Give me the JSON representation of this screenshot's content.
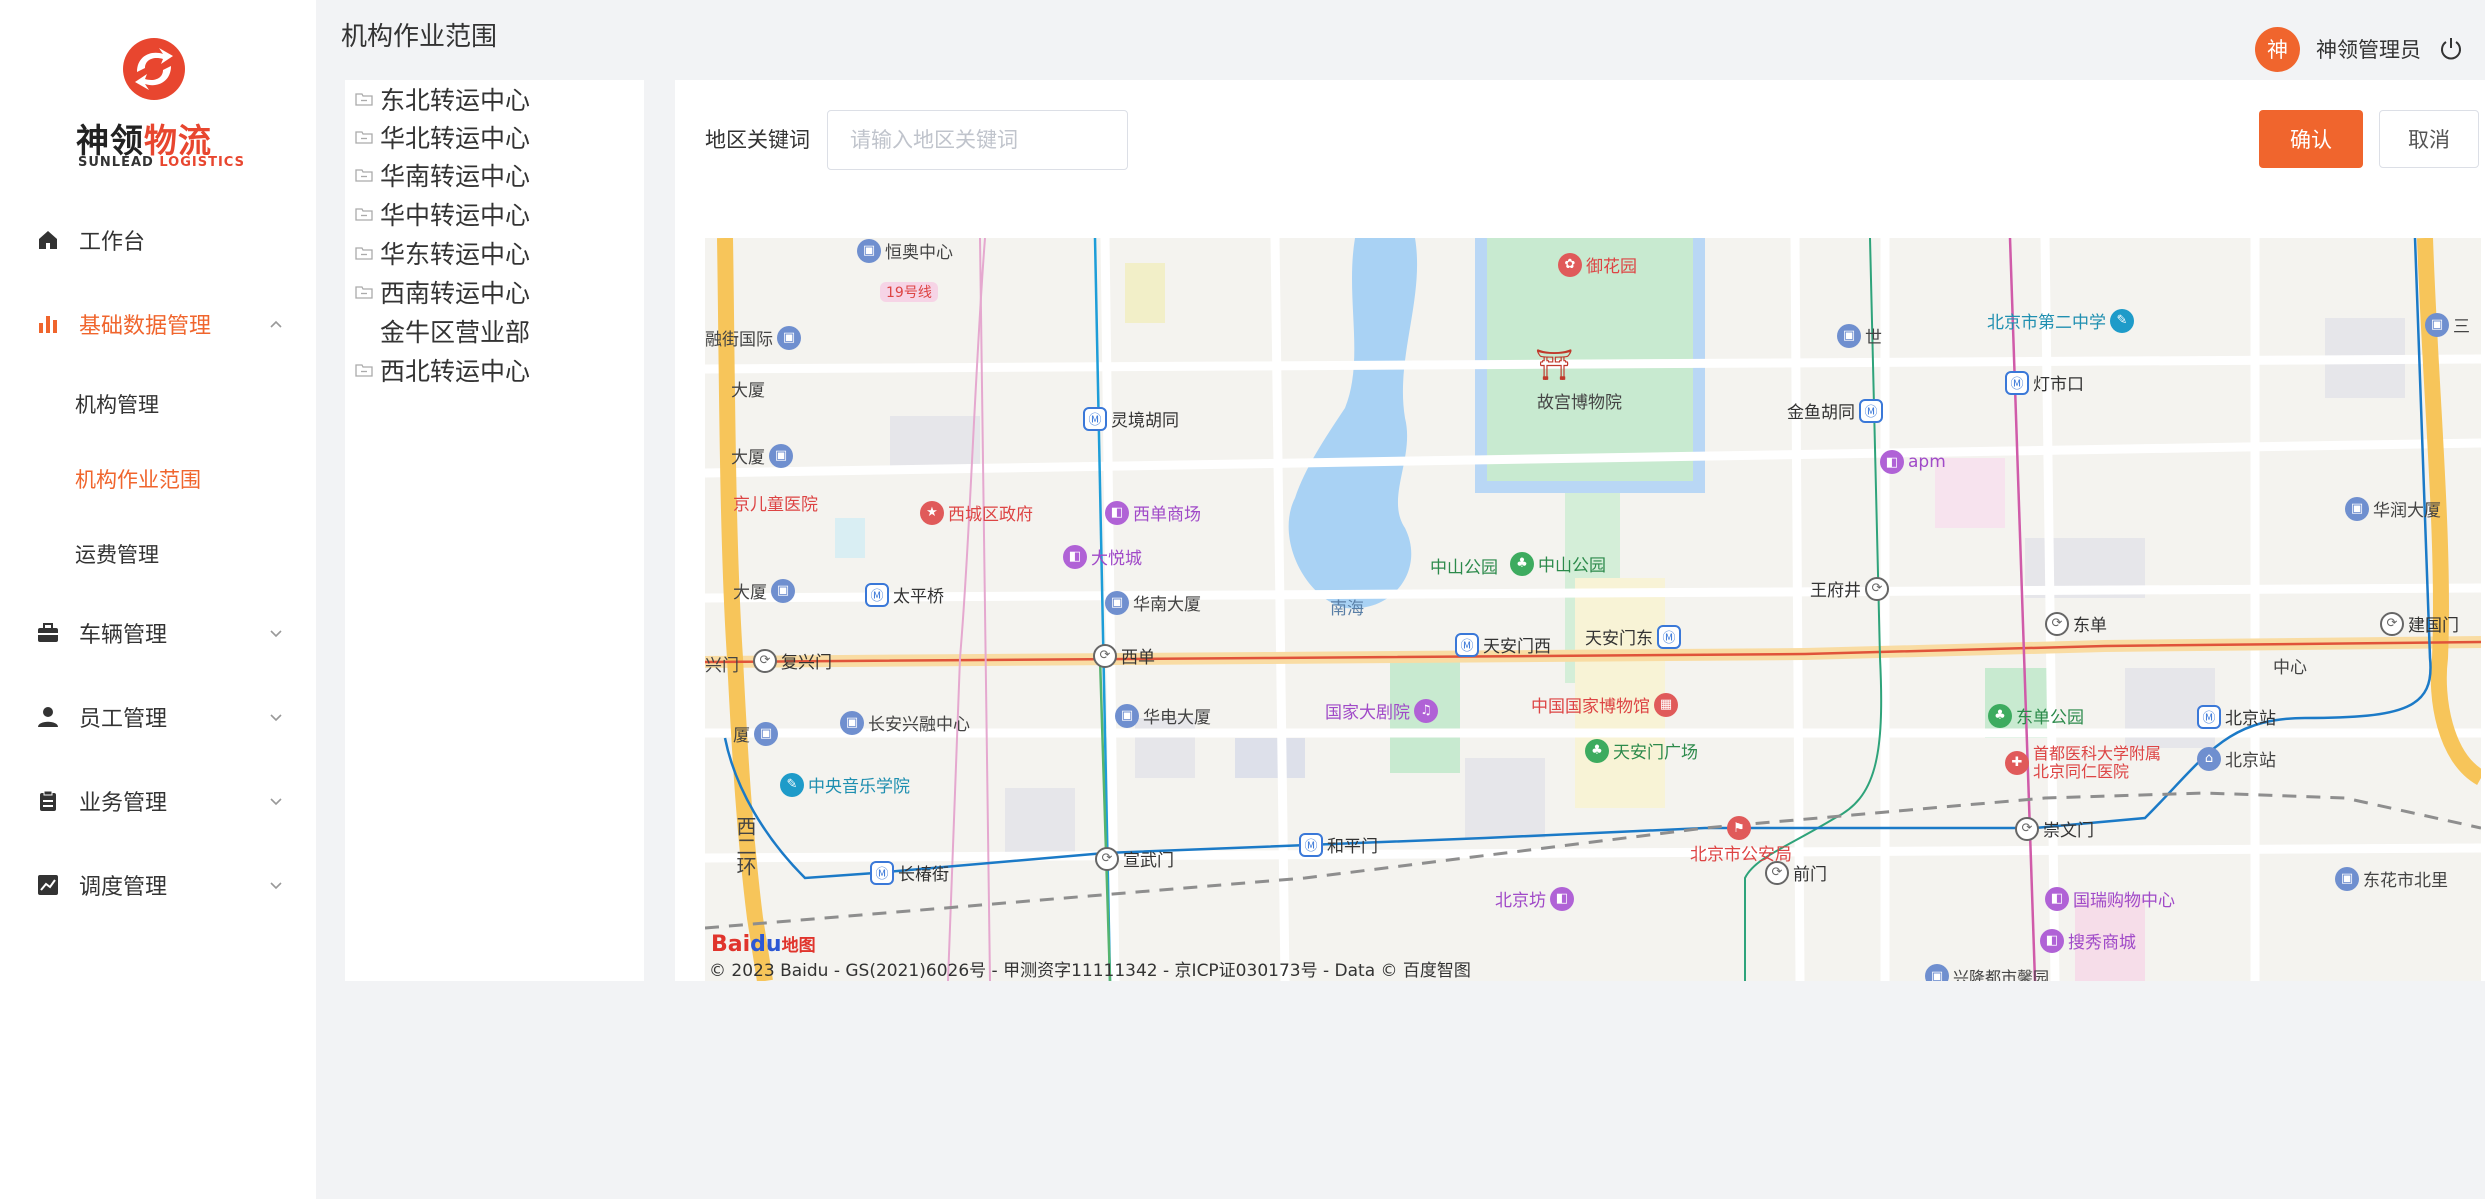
{
  "logo": {
    "brand_a": "神领",
    "brand_b": "物流",
    "sub_a": "SUNLEAD",
    "sub_b": "LOGISTICS"
  },
  "menu": {
    "workbench": "工作台",
    "basic_data": "基础数据管理",
    "sub": {
      "org": "机构管理",
      "org_scope": "机构作业范围",
      "freight": "运费管理"
    },
    "vehicle": "车辆管理",
    "staff": "员工管理",
    "business": "业务管理",
    "dispatch": "调度管理"
  },
  "header": {
    "title": "机构作业范围",
    "avatar_char": "神",
    "user_name": "神领管理员"
  },
  "tree": [
    {
      "label": "东北转运中心",
      "folder": true
    },
    {
      "label": "华北转运中心",
      "folder": true
    },
    {
      "label": "华南转运中心",
      "folder": true
    },
    {
      "label": "华中转运中心",
      "folder": true
    },
    {
      "label": "华东转运中心",
      "folder": true
    },
    {
      "label": "西南转运中心",
      "folder": true
    },
    {
      "label": "金牛区营业部",
      "folder": false
    },
    {
      "label": "西北转运中心",
      "folder": true
    }
  ],
  "search": {
    "label": "地区关键词",
    "placeholder": "请输入地区关键词",
    "value": ""
  },
  "buttons": {
    "confirm": "确认",
    "cancel": "取消"
  },
  "map": {
    "pois": {
      "hengao": "恒奥中心",
      "line19": "19号线",
      "rongjie": "融街国际",
      "dasha1": "大厦",
      "dasha2": "大厦",
      "dasha3": "大厦",
      "dasha4": "厦",
      "ertong": "京儿童医院",
      "lingjing": "灵境胡同",
      "xicheng_gov": "西城区政府",
      "xidan_mall": "西单商场",
      "joycity": "大悦城",
      "taipingqiao": "太平桥",
      "xinan_dasha": "华南大厦",
      "yuhuayuan": "御花园",
      "gugong": "故宫博物院",
      "zhongshan_a": "中山公园",
      "zhongshan_b": "中山公园",
      "nanhai": "南海",
      "jinyu": "金鱼胡同",
      "apm": "apm",
      "wangfujing": "王府井",
      "dengshikou": "灯市口",
      "bj2school": "北京市第二中学",
      "shi": "世",
      "huarun": "华润大厦",
      "san": "三",
      "fuxingmen_a": "兴门",
      "fuxingmen": "复兴门",
      "xidan": "西单",
      "tiananmen_w": "天安门西",
      "tiananmen_e": "天安门东",
      "dongdan": "东单",
      "jianguomen": "建国门",
      "zhongxin": "中心",
      "changan": "长安兴融中心",
      "huadian": "华电大厦",
      "national_theater": "国家大剧院",
      "national_museum": "中国国家博物馆",
      "tam_square": "天安门广场",
      "dongdan_park": "东单公园",
      "tongren": "首都医科大学附属北京同仁医院",
      "bj_station": "北京站",
      "bj_station2": "北京站",
      "music": "中央音乐学院",
      "xierhuan": "西二环",
      "changchunjie": "长椿街",
      "xuanwumen": "宣武门",
      "hepingmen": "和平门",
      "public_security": "北京市公安局",
      "chongwenmen": "崇文门",
      "qianmen": "前门",
      "beijingfang": "北京坊",
      "guorui": "国瑞购物中心",
      "souxiu": "搜秀商城",
      "longfu": "兴隆都市馨园",
      "dongcheng_n": "东花市北里"
    },
    "logo_a": "Bai",
    "logo_b": "du",
    "logo_c": "地图",
    "copyright": "© 2023 Baidu - GS(2021)6026号 - 甲测资字11111342 - 京ICP证030173号 - Data © 百度智图"
  },
  "colors": {
    "accent": "#f0652d",
    "brand_red": "#e8462f"
  }
}
